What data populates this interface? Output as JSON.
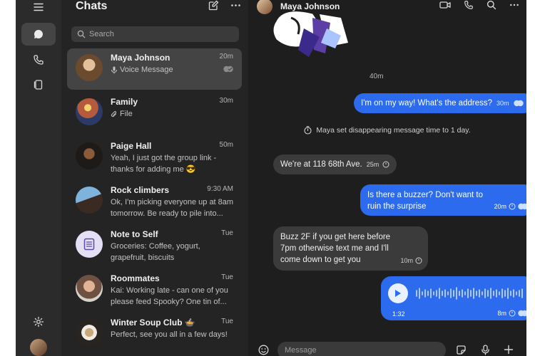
{
  "sidebar": {
    "title": "Chats",
    "search_placeholder": "Search"
  },
  "chats": [
    {
      "name": "Maya Johnson",
      "time": "20m",
      "preview": "Voice Message",
      "preview_icon": "mic-icon",
      "active": true
    },
    {
      "name": "Family",
      "time": "30m",
      "preview": "File",
      "preview_icon": "paperclip-icon"
    },
    {
      "name": "Paige Hall",
      "time": "50m",
      "preview": "Yeah, I just got the group link - thanks for adding me 😎"
    },
    {
      "name": "Rock climbers",
      "time": "9:30 AM",
      "preview": "Ok, I'm picking everyone up at 8am tomorrow. Be ready to pile into..."
    },
    {
      "name": "Note to Self",
      "time": "Tue",
      "preview": "Groceries: Coffee, yogurt, grapefruit, biscuits"
    },
    {
      "name": "Roommates",
      "time": "Tue",
      "preview": "Kai: Working late - can one of you please feed Spooky? One tin of..."
    },
    {
      "name": "Winter Soup Club 🍲",
      "time": "Tue",
      "preview": "Perfect, see you all in a few days!"
    }
  ],
  "conversation": {
    "contact_name": "Maya Johnson",
    "sticker_time": "40m",
    "system_message": "Maya set disappearing message time to 1 day.",
    "messages": [
      {
        "text": "I'm on my way! What's the address?",
        "time": "30m",
        "direction": "out"
      },
      {
        "text": "We're at 118 68th Ave.",
        "time": "25m",
        "direction": "in"
      },
      {
        "text": "Is there a buzzer? Don't want to ruin the surprise",
        "time": "20m",
        "direction": "out"
      },
      {
        "text": "Buzz 2F if you get here before 7pm otherwise text me and I'll come down to get you",
        "time": "10m",
        "direction": "in"
      }
    ],
    "voice_message": {
      "duration": "1:32",
      "time": "8m"
    },
    "composer_placeholder": "Message"
  },
  "colors": {
    "accent": "#2c6bed",
    "incoming": "#3b3b3b",
    "background": "#1e1e1e",
    "list": "#242424",
    "rail": "#2b2b2b"
  }
}
